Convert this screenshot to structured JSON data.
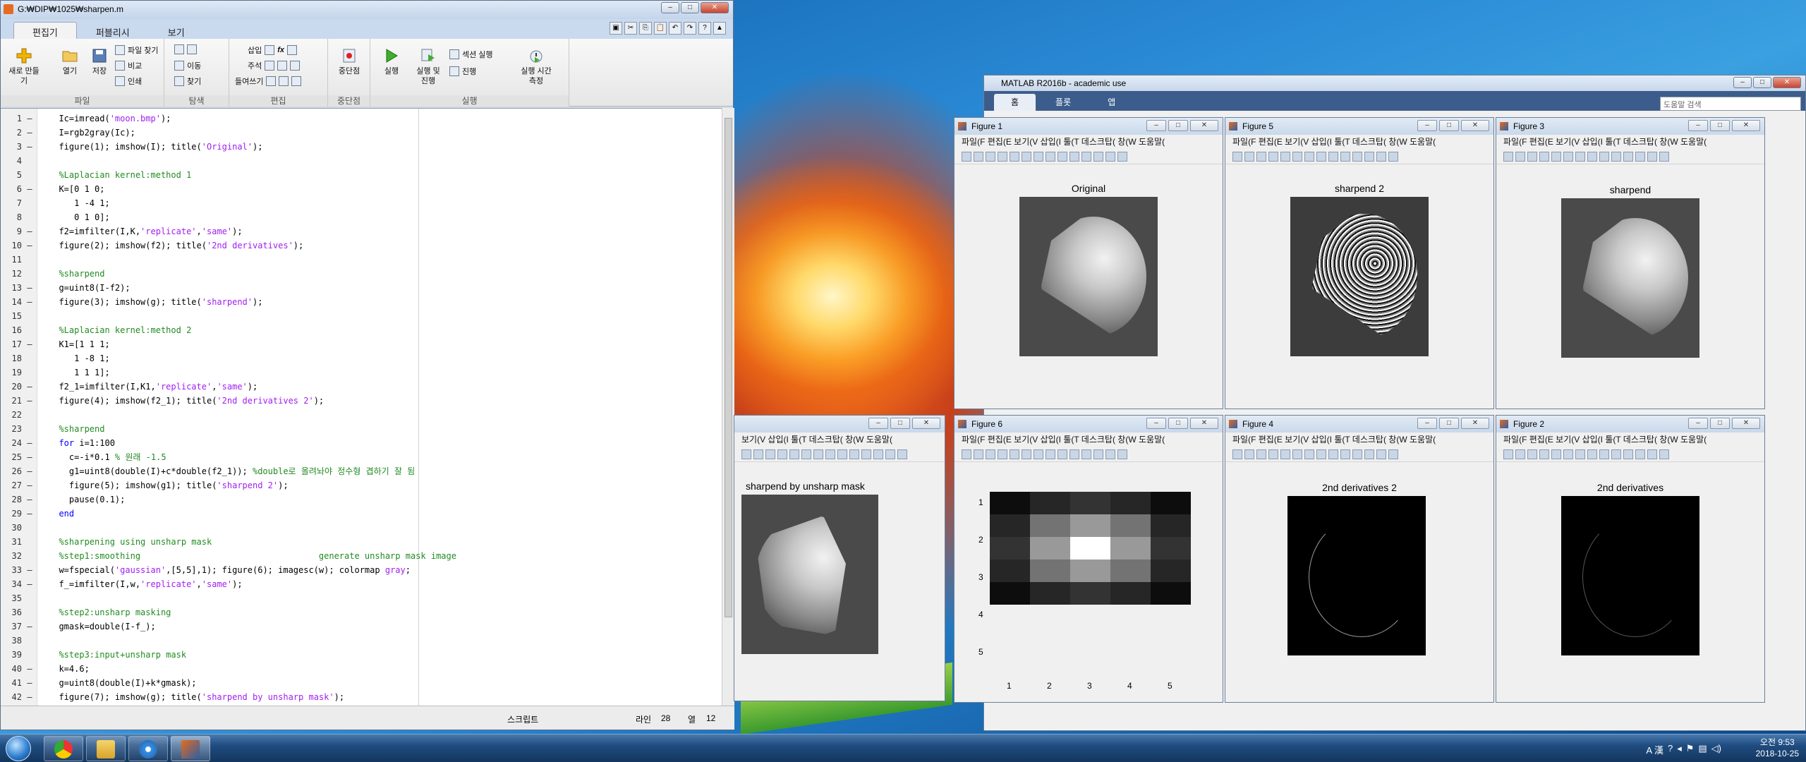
{
  "editor": {
    "title": "G:₩DIP₩1025₩sharpen.m",
    "tabs": [
      "편집기",
      "퍼블리시",
      "보기"
    ],
    "ribbon": {
      "file": {
        "label": "파일",
        "new": "새로 만들기",
        "open": "열기",
        "save": "저장",
        "find_files": "파일 찾기",
        "compare": "비교",
        "print": "인쇄"
      },
      "navigate": {
        "label": "탐색",
        "goto": "이동",
        "find": "찾기"
      },
      "edit": {
        "label": "편집",
        "insert": "삽입",
        "comment": "주석",
        "indent": "들여쓰기",
        "fx": "fx"
      },
      "breakpoints": {
        "label": "중단점",
        "bp": "중단점"
      },
      "run": {
        "label": "실행",
        "run": "실행",
        "run_advance": "실행 및\n진행",
        "run_section": "섹션 실행",
        "advance": "진행",
        "run_time": "실행 시간\n측정"
      }
    },
    "code_lines": [
      {
        "n": "1",
        "d": "–",
        "t": [
          [
            "",
            "  Ic=imread("
          ],
          [
            "st",
            "'moon.bmp'"
          ],
          [
            "",
            ");"
          ]
        ]
      },
      {
        "n": "2",
        "d": "–",
        "t": [
          [
            "",
            "  I=rgb2gray(Ic);"
          ]
        ]
      },
      {
        "n": "3",
        "d": "–",
        "t": [
          [
            "",
            "  figure(1); imshow(I); title("
          ],
          [
            "st",
            "'Original'"
          ],
          [
            "",
            ");"
          ]
        ]
      },
      {
        "n": "4",
        "d": "",
        "t": []
      },
      {
        "n": "5",
        "d": "",
        "t": [
          [
            "cm",
            "  %Laplacian kernel:method 1"
          ]
        ]
      },
      {
        "n": "6",
        "d": "–",
        "t": [
          [
            "",
            "  K=[0 1 0;"
          ]
        ]
      },
      {
        "n": "7",
        "d": "",
        "t": [
          [
            "",
            "     1 -4 1;"
          ]
        ]
      },
      {
        "n": "8",
        "d": "",
        "t": [
          [
            "",
            "     0 1 0];"
          ]
        ]
      },
      {
        "n": "9",
        "d": "–",
        "t": [
          [
            "",
            "  f2=imfilter(I,K,"
          ],
          [
            "st",
            "'replicate'"
          ],
          [
            "",
            ","
          ],
          [
            "st",
            "'same'"
          ],
          [
            "",
            ");"
          ]
        ]
      },
      {
        "n": "10",
        "d": "–",
        "t": [
          [
            "",
            "  figure(2); imshow(f2); title("
          ],
          [
            "st",
            "'2nd derivatives'"
          ],
          [
            "",
            ");"
          ]
        ]
      },
      {
        "n": "11",
        "d": "",
        "t": []
      },
      {
        "n": "12",
        "d": "",
        "t": [
          [
            "cm",
            "  %sharpend"
          ]
        ]
      },
      {
        "n": "13",
        "d": "–",
        "t": [
          [
            "",
            "  g=uint8(I-f2);"
          ]
        ]
      },
      {
        "n": "14",
        "d": "–",
        "t": [
          [
            "",
            "  figure(3); imshow(g); title("
          ],
          [
            "st",
            "'sharpend'"
          ],
          [
            "",
            ");"
          ]
        ]
      },
      {
        "n": "15",
        "d": "",
        "t": []
      },
      {
        "n": "16",
        "d": "",
        "t": [
          [
            "cm",
            "  %Laplacian kernel:method 2"
          ]
        ]
      },
      {
        "n": "17",
        "d": "–",
        "t": [
          [
            "",
            "  K1=[1 1 1;"
          ]
        ]
      },
      {
        "n": "18",
        "d": "",
        "t": [
          [
            "",
            "     1 -8 1;"
          ]
        ]
      },
      {
        "n": "19",
        "d": "",
        "t": [
          [
            "",
            "     1 1 1];"
          ]
        ]
      },
      {
        "n": "20",
        "d": "–",
        "t": [
          [
            "",
            "  f2_1=imfilter(I,K1,"
          ],
          [
            "st",
            "'replicate'"
          ],
          [
            "",
            ","
          ],
          [
            "st",
            "'same'"
          ],
          [
            "",
            ");"
          ]
        ]
      },
      {
        "n": "21",
        "d": "–",
        "t": [
          [
            "",
            "  figure(4); imshow(f2_1); title("
          ],
          [
            "st",
            "'2nd derivatives 2'"
          ],
          [
            "",
            ");"
          ]
        ]
      },
      {
        "n": "22",
        "d": "",
        "t": []
      },
      {
        "n": "23",
        "d": "",
        "t": [
          [
            "cm",
            "  %sharpend"
          ]
        ]
      },
      {
        "n": "24",
        "d": "–",
        "t": [
          [
            "kw",
            "  for "
          ],
          [
            "",
            "i=1:100"
          ]
        ]
      },
      {
        "n": "25",
        "d": "–",
        "t": [
          [
            "",
            "    c=-i*0.1 "
          ],
          [
            "cm",
            "% 원래 -1.5"
          ]
        ]
      },
      {
        "n": "26",
        "d": "–",
        "t": [
          [
            "",
            "    g1=uint8(double(I)+c*double(f2_1)); "
          ],
          [
            "cm",
            "%double로 올려놔야 정수형 겹하기 잘 됨"
          ]
        ]
      },
      {
        "n": "27",
        "d": "–",
        "t": [
          [
            "",
            "    figure(5); imshow(g1); title("
          ],
          [
            "st",
            "'sharpend 2'"
          ],
          [
            "",
            ");"
          ]
        ]
      },
      {
        "n": "28",
        "d": "–",
        "t": [
          [
            "",
            "    pause(0.1);"
          ]
        ]
      },
      {
        "n": "29",
        "d": "–",
        "t": [
          [
            "kw",
            "  end"
          ]
        ]
      },
      {
        "n": "30",
        "d": "",
        "t": []
      },
      {
        "n": "31",
        "d": "",
        "t": [
          [
            "cm",
            "  %sharpening using unsharp mask"
          ]
        ]
      },
      {
        "n": "32",
        "d": "",
        "t": [
          [
            "cm",
            "  %step1:smoothing                                   generate unsharp mask image"
          ]
        ]
      },
      {
        "n": "33",
        "d": "–",
        "t": [
          [
            "",
            "  w=fspecial("
          ],
          [
            "st",
            "'gaussian'"
          ],
          [
            "",
            ",[5,5],1); figure(6); imagesc(w); colormap "
          ],
          [
            "st",
            "gray"
          ],
          [
            "",
            ";"
          ]
        ]
      },
      {
        "n": "34",
        "d": "–",
        "t": [
          [
            "",
            "  f_=imfilter(I,w,"
          ],
          [
            "st",
            "'replicate'"
          ],
          [
            "",
            ","
          ],
          [
            "st",
            "'same'"
          ],
          [
            "",
            ");"
          ]
        ]
      },
      {
        "n": "35",
        "d": "",
        "t": []
      },
      {
        "n": "36",
        "d": "",
        "t": [
          [
            "cm",
            "  %step2:unsharp masking"
          ]
        ]
      },
      {
        "n": "37",
        "d": "–",
        "t": [
          [
            "",
            "  gmask=double(I-f_);"
          ]
        ]
      },
      {
        "n": "38",
        "d": "",
        "t": []
      },
      {
        "n": "39",
        "d": "",
        "t": [
          [
            "cm",
            "  %step3:input+unsharp mask"
          ]
        ]
      },
      {
        "n": "40",
        "d": "–",
        "t": [
          [
            "",
            "  k=4.6;"
          ]
        ]
      },
      {
        "n": "41",
        "d": "–",
        "t": [
          [
            "",
            "  g=uint8(double(I)+k*gmask);"
          ]
        ]
      },
      {
        "n": "42",
        "d": "–",
        "t": [
          [
            "",
            "  figure(7); imshow(g); title("
          ],
          [
            "st",
            "'sharpend by unsharp mask'"
          ],
          [
            "",
            ");"
          ]
        ]
      }
    ],
    "status": {
      "type": "스크립트",
      "line_label": "라인",
      "line": "28",
      "col_label": "열",
      "col": "12"
    }
  },
  "matlab": {
    "title": "MATLAB R2016b - academic use",
    "tabs": [
      "홈",
      "플롯",
      "앱"
    ],
    "search_placeholder": "도움말 검색"
  },
  "figures": [
    {
      "id": "fig1",
      "title": "Figure 1",
      "plot_title": "Original"
    },
    {
      "id": "fig5",
      "title": "Figure 5",
      "plot_title": "sharpend 2"
    },
    {
      "id": "fig3",
      "title": "Figure 3",
      "plot_title": "sharpend"
    },
    {
      "id": "fig7",
      "title": "",
      "plot_title": "sharpend by unsharp mask"
    },
    {
      "id": "fig6",
      "title": "Figure 6",
      "plot_title": ""
    },
    {
      "id": "fig4",
      "title": "Figure 4",
      "plot_title": "2nd derivatives 2"
    },
    {
      "id": "fig2",
      "title": "Figure 2",
      "plot_title": "2nd derivatives"
    }
  ],
  "figure_menu": "파일(F  편집(E  보기(V  삽입(I  툴(T  데스크탑(  창(W  도움말(",
  "figure_menu_short": "보기(V  삽입(I  툴(T  데스크탑(  창(W  도움말(",
  "heatmap": {
    "ticks": [
      "1",
      "2",
      "3",
      "4",
      "5"
    ]
  },
  "taskbar": {
    "time": "오전 9:53",
    "date": "2018-10-25",
    "ime": "A 漢"
  }
}
